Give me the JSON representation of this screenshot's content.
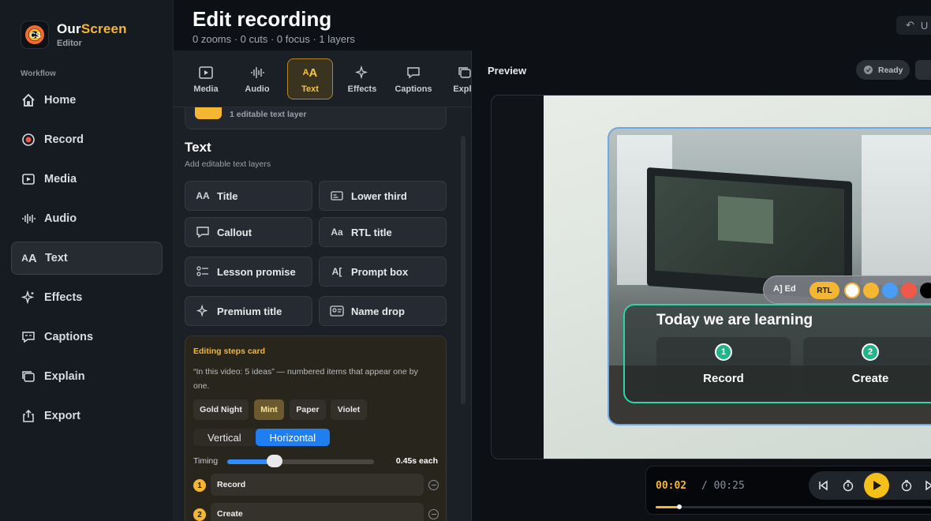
{
  "app": {
    "name_part1": "Our",
    "name_part2": "Screen",
    "subtitle": "Editor"
  },
  "sidebar": {
    "section_label": "Workflow",
    "items": [
      {
        "label": "Home",
        "icon": "home-icon"
      },
      {
        "label": "Record",
        "icon": "record-icon"
      },
      {
        "label": "Media",
        "icon": "media-icon"
      },
      {
        "label": "Audio",
        "icon": "audio-icon"
      },
      {
        "label": "Text",
        "icon": "text-icon",
        "active": true
      },
      {
        "label": "Effects",
        "icon": "sparkle-icon"
      },
      {
        "label": "Captions",
        "icon": "captions-icon"
      },
      {
        "label": "Explain",
        "icon": "explain-icon"
      },
      {
        "label": "Export",
        "icon": "export-icon"
      }
    ]
  },
  "header": {
    "title": "Edit recording",
    "stats": "0 zooms · 0 cuts · 0 focus · 1 layers",
    "undo_label": "U"
  },
  "panel": {
    "tabs": [
      {
        "label": "Media",
        "icon": "media-icon"
      },
      {
        "label": "Audio",
        "icon": "audio-icon"
      },
      {
        "label": "Text",
        "icon": "text-icon",
        "active": true
      },
      {
        "label": "Effects",
        "icon": "sparkle-icon"
      },
      {
        "label": "Captions",
        "icon": "captions-icon"
      },
      {
        "label": "Expla",
        "icon": "explain-icon"
      }
    ],
    "layer_count_text": "1 editable text layer",
    "section_title": "Text",
    "section_subtitle": "Add editable text layers",
    "presets": [
      {
        "label": "Title",
        "icon_text": "AA"
      },
      {
        "label": "Lower third",
        "icon": "lower-third-icon"
      },
      {
        "label": "Callout",
        "icon": "callout-icon"
      },
      {
        "label": "RTL title",
        "icon_text": "Aa"
      },
      {
        "label": "Lesson promise",
        "icon": "checklist-icon"
      },
      {
        "label": "Prompt box",
        "icon_text": "A["
      },
      {
        "label": "Premium title",
        "icon": "sparkle-icon"
      },
      {
        "label": "Name drop",
        "icon": "name-card-icon"
      }
    ],
    "steps_card": {
      "title": "Editing steps card",
      "description": "“In this video: 5 ideas” — numbered items that appear one by one.",
      "themes": [
        "Gold Night",
        "Mint",
        "Paper",
        "Violet"
      ],
      "active_theme": "Mint",
      "orientation": [
        "Vertical",
        "Horizontal"
      ],
      "active_orientation": "Horizontal",
      "timing_label": "Timing",
      "timing_value": "0.45s each",
      "timing_fraction": 0.32,
      "steps": [
        {
          "num": "1",
          "value": "Record"
        },
        {
          "num": "2",
          "value": "Create"
        }
      ]
    }
  },
  "preview": {
    "label": "Preview",
    "status": "Ready",
    "toolbar": {
      "text_tools": "A] Ed",
      "rtl_label": "RTL",
      "swatches": [
        "#ffffff",
        "#f5b731",
        "#4a9cf5",
        "#f0584a",
        "#000000"
      ]
    },
    "overlay": {
      "title": "Today we are learning",
      "steps": [
        {
          "num": "1",
          "label": "Record"
        },
        {
          "num": "2",
          "label": "Create"
        }
      ]
    }
  },
  "transport": {
    "current": "00:02",
    "total": "/ 00:25",
    "progress_fraction": 0.08
  },
  "colors": {
    "accent": "#f5b731",
    "blue": "#1f7ef0",
    "mint": "#2fd3a6"
  }
}
